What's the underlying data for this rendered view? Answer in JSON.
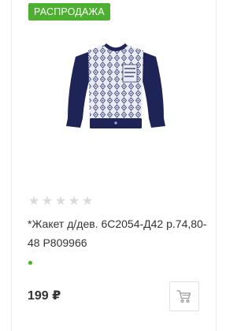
{
  "product": {
    "badge": "РАСПРОДАЖА",
    "name": "*Жакет д/дев. 6С2054-Д42 р.74,80-48 Р809966",
    "price": "199 ₽",
    "rating": {
      "max": 5,
      "value": 0,
      "star_glyph": "★"
    },
    "in_stock": true
  },
  "icons": {
    "cart": "cart-icon"
  },
  "colors": {
    "badge_bg": "#4caf2f",
    "stock_dot": "#4caf2f",
    "star_empty": "#dadada",
    "jacket_navy": "#1f2457",
    "jacket_pattern_bg": "#e9ebf2"
  }
}
